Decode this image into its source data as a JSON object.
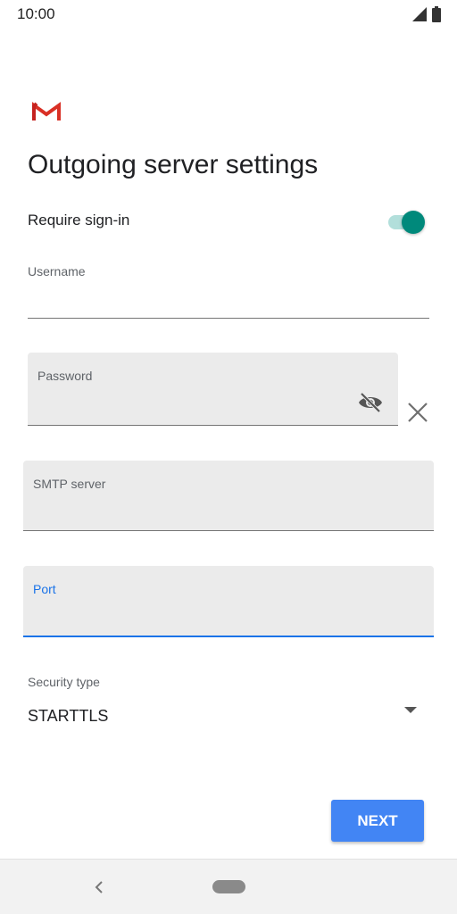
{
  "status_bar": {
    "time": "10:00",
    "icons": [
      "signal-icon",
      "battery-icon"
    ]
  },
  "app": {
    "logo": "gmail-logo",
    "title": "Outgoing server settings"
  },
  "require_signin": {
    "label": "Require sign-in",
    "enabled": true
  },
  "fields": {
    "username": {
      "label": "Username",
      "value": ""
    },
    "password": {
      "label": "Password",
      "value": ""
    },
    "smtp_server": {
      "label": "SMTP server",
      "value": ""
    },
    "port": {
      "label": "Port",
      "value": "",
      "focused": true
    }
  },
  "security": {
    "label": "Security type",
    "selected": "STARTTLS"
  },
  "actions": {
    "next_label": "NEXT"
  },
  "colors": {
    "accent": "#4285f4",
    "toggle_on": "#00897b",
    "focus": "#1a73e8",
    "gmail_red": "#d93025"
  }
}
